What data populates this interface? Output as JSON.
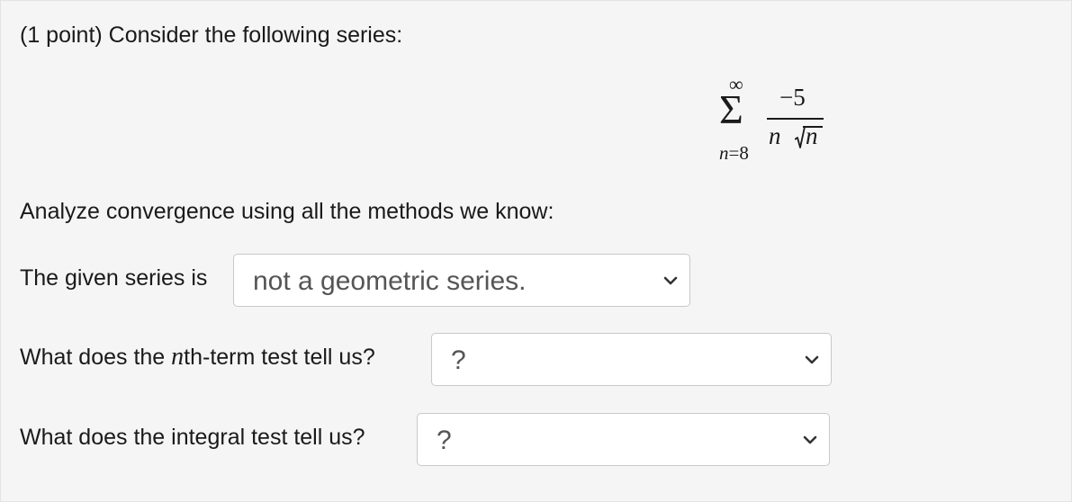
{
  "problem": {
    "intro": "(1 point) Consider the following series:",
    "analyze": "Analyze convergence using all the methods we know:"
  },
  "series": {
    "upper_limit": "∞",
    "sigma": "Σ",
    "index_var": "n",
    "index_eq": "=8",
    "numerator": "−5",
    "denom_coef": "n",
    "denom_radicand": "n"
  },
  "q1": {
    "label": "The given series is",
    "selected": "not a geometric series."
  },
  "q2": {
    "label_pre": "What does the ",
    "label_var": "n",
    "label_post": "th-term test tell us?",
    "selected": "?"
  },
  "q3": {
    "label": "What does the integral test tell us?",
    "selected": "?"
  },
  "icons": {
    "dropdown": "chevron-down-icon",
    "radical": "square-root-icon"
  },
  "colors": {
    "panel_bg": "#f5f5f5",
    "text": "#1a1a1a",
    "select_text": "#555555",
    "select_border": "#c9c9c9"
  }
}
